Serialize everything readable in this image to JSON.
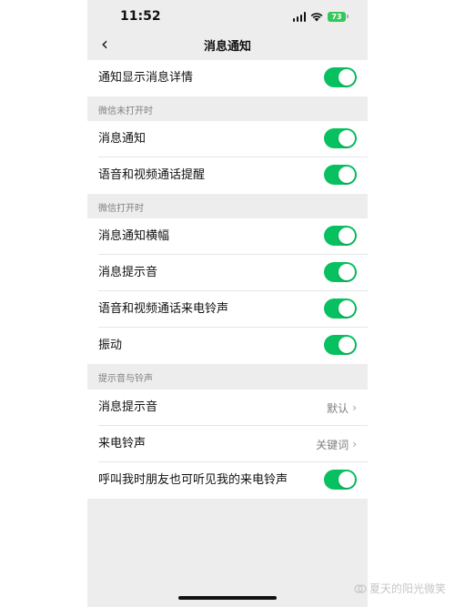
{
  "status_bar": {
    "time": "11:52",
    "battery": "73"
  },
  "nav": {
    "back": "‹",
    "title": "消息通知"
  },
  "rows": {
    "show_details": "通知显示消息详情",
    "closed_notify": "消息通知",
    "closed_call_remind": "语音和视频通话提醒",
    "open_banner": "消息通知横幅",
    "open_sound": "消息提示音",
    "open_ringtone": "语音和视频通话来电铃声",
    "open_vibrate": "振动",
    "tone_message": "消息提示音",
    "tone_ringtone": "来电铃声",
    "friend_hear": "呼叫我时朋友也可听见我的来电铃声"
  },
  "values": {
    "tone_message": "默认",
    "tone_ringtone": "关键词"
  },
  "sections": {
    "closed": "微信未打开时",
    "opened": "微信打开时",
    "tones": "提示音与铃声"
  },
  "watermark": "夏天的阳光微笑",
  "colors": {
    "toggle_on": "#07c160",
    "background": "#ededed",
    "battery": "#34c759"
  }
}
